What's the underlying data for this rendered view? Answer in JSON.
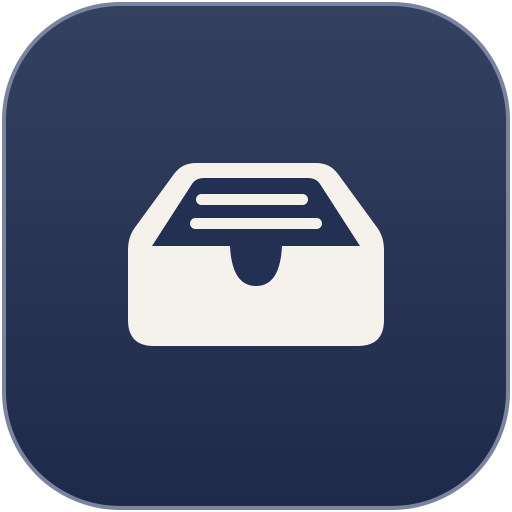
{
  "icon": {
    "name": "inbox-tray-icon",
    "background_top": "#34405F",
    "background_bottom": "#1F2A4A",
    "glyph_color": "#F5F1EB",
    "rim_light": "#7A84A0"
  }
}
